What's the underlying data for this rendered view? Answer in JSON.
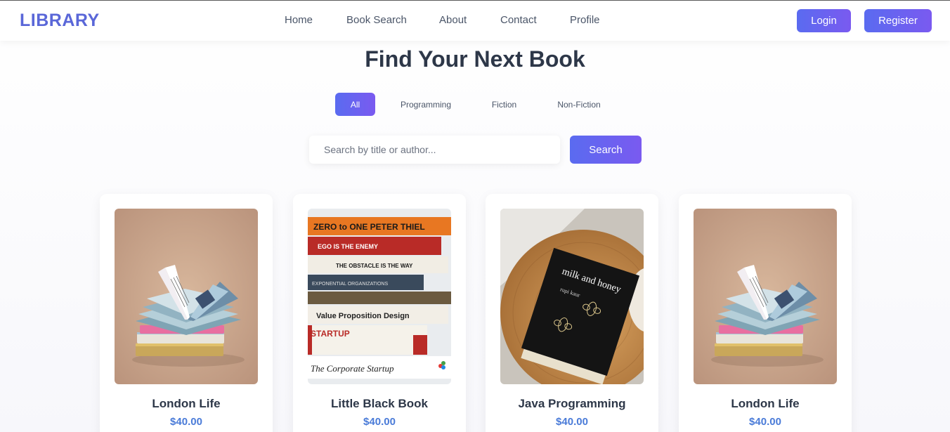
{
  "nav": {
    "brand": "LIBRARY",
    "links": [
      "Home",
      "Book Search",
      "About",
      "Contact",
      "Profile"
    ],
    "login_label": "Login",
    "register_label": "Register"
  },
  "hero": {
    "title": "Find Your Next Book"
  },
  "filters": {
    "items": [
      "All",
      "Programming",
      "Fiction",
      "Non-Fiction"
    ],
    "active": "All"
  },
  "search": {
    "placeholder": "Search by title or author...",
    "value": "",
    "button_label": "Search"
  },
  "books": [
    {
      "title": "London Life",
      "price": "$40.00",
      "cover_icon": "open-book-stack-image"
    },
    {
      "title": "Little Black Book",
      "price": "$40.00",
      "cover_icon": "book-spines-stack-image"
    },
    {
      "title": "Java Programming",
      "price": "$40.00",
      "cover_icon": "milk-and-honey-book-image"
    },
    {
      "title": "London Life",
      "price": "$40.00",
      "cover_icon": "open-book-stack-image"
    }
  ],
  "cover_text": {
    "spines": [
      "ZERO to ONE PETER THIEL",
      "EGO IS THE ENEMY",
      "THE OBSTACLE IS THE WAY",
      "EXPONENTIAL ORGANIZATIONS",
      "Value Proposition Design",
      "STARTUP",
      "The Corporate Startup"
    ],
    "milk_title": "milk and honey",
    "milk_author": "rupi kaur"
  },
  "colors": {
    "brand": "#5a67d8",
    "accent_start": "#5a6bf0",
    "accent_end": "#7a5af0",
    "price": "#4a7bd8",
    "text": "#2d3748"
  }
}
